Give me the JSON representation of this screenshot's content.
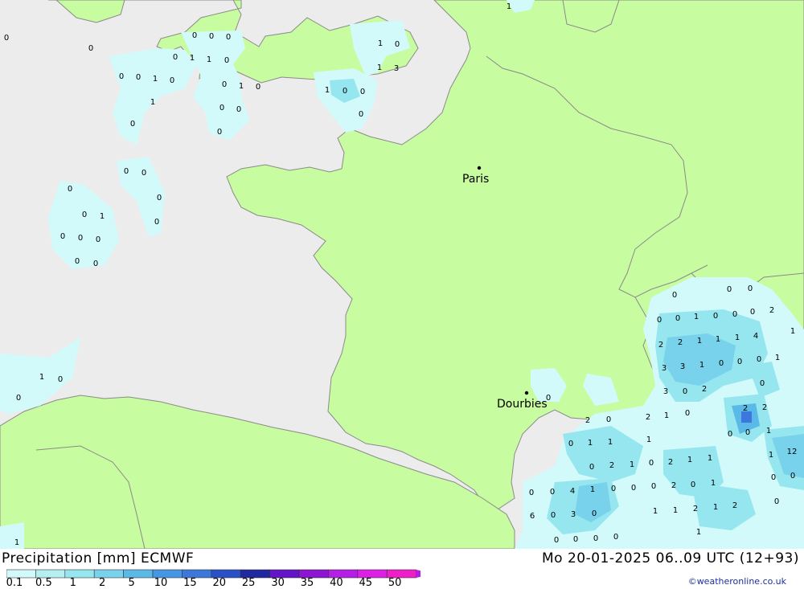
{
  "footer": {
    "title": "Precipitation [mm] ECMWF",
    "run_info": "Mo 20-01-2025 06..09 UTC (12+93)",
    "credit": "©weatheronline.co.uk"
  },
  "cities": [
    {
      "name": "Paris"
    },
    {
      "name": "Dourbies"
    }
  ],
  "legend": {
    "ticks": [
      "0.1",
      "0.5",
      "1",
      "2",
      "5",
      "10",
      "15",
      "20",
      "25",
      "30",
      "35",
      "40",
      "45",
      "50"
    ],
    "colors": [
      "#d2fafa",
      "#b4f0f0",
      "#96e6f0",
      "#78d2eb",
      "#5ab9e6",
      "#4696e6",
      "#3c78dc",
      "#2850c8",
      "#1e28a0",
      "#6414c8",
      "#8c14d2",
      "#b41ee6",
      "#dc1ee6",
      "#f01ec8"
    ]
  },
  "precip_labels": [
    "0",
    "0",
    "0",
    "0",
    "0",
    "0",
    "1",
    "1",
    "0",
    "0",
    "0",
    "1",
    "0",
    "1",
    "0",
    "0",
    "1",
    "0",
    "0",
    "0",
    "0",
    "0",
    "0",
    "0",
    "0",
    "0",
    "1",
    "0",
    "0",
    "0",
    "0",
    "1",
    "0",
    "1",
    "3",
    "1",
    "0",
    "0",
    "0",
    "0",
    "0",
    "0",
    "1",
    "0",
    "1",
    "1",
    "0",
    "0",
    "0",
    "0",
    "0",
    "1",
    "0",
    "0",
    "0",
    "2",
    "1",
    "2",
    "2",
    "1",
    "1",
    "1",
    "4",
    "3",
    "3",
    "1",
    "0",
    "0",
    "0",
    "1",
    "3",
    "0",
    "2",
    "0",
    "0",
    "2",
    "0",
    "2",
    "1",
    "0",
    "2",
    "2",
    "1",
    "0",
    "1",
    "1",
    "1",
    "0",
    "0",
    "0",
    "2",
    "1",
    "0",
    "2",
    "1",
    "1",
    "12",
    "1",
    "0",
    "0",
    "4",
    "1",
    "0",
    "0",
    "0",
    "2",
    "0",
    "1",
    "0",
    "0",
    "6",
    "0",
    "3",
    "0",
    "0",
    "0",
    "0",
    "0",
    "1",
    "1",
    "2",
    "1",
    "2",
    "0",
    "1"
  ]
}
